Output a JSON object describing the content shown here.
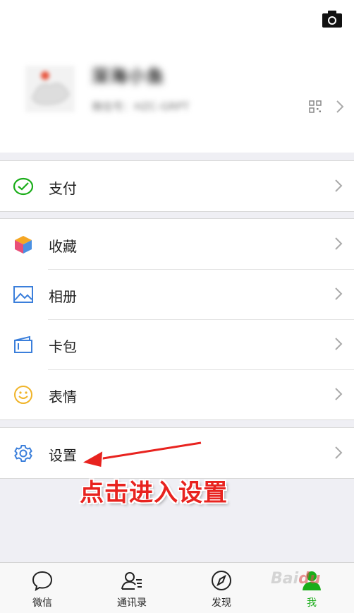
{
  "profile": {
    "nickname": "深海小鱼",
    "wechat_id": "微信号：HZC-GRPT"
  },
  "sections": [
    {
      "items": [
        {
          "label": "支付",
          "icon": "wechat-pay-icon"
        }
      ]
    },
    {
      "items": [
        {
          "label": "收藏",
          "icon": "cube-icon"
        },
        {
          "label": "相册",
          "icon": "image-icon"
        },
        {
          "label": "卡包",
          "icon": "card-wallet-icon"
        },
        {
          "label": "表情",
          "icon": "smiley-icon"
        }
      ]
    },
    {
      "items": [
        {
          "label": "设置",
          "icon": "gear-icon"
        }
      ]
    }
  ],
  "tabbar": [
    {
      "label": "微信",
      "icon": "chat-bubble-icon",
      "active": false
    },
    {
      "label": "通讯录",
      "icon": "contacts-icon",
      "active": false
    },
    {
      "label": "发现",
      "icon": "compass-icon",
      "active": false
    },
    {
      "label": "我",
      "icon": "person-icon",
      "active": true
    }
  ],
  "annotation": {
    "text": "点击进入设置"
  },
  "colors": {
    "active_tab": "#1aad19",
    "annotation": "#e8231f",
    "background": "#efeff4"
  }
}
